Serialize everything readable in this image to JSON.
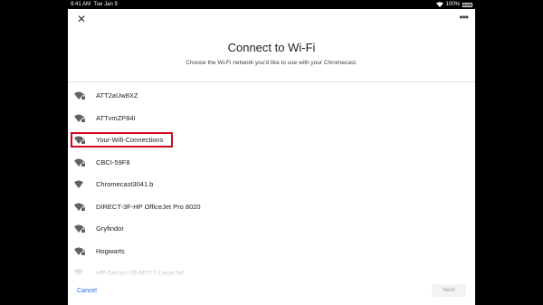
{
  "status_bar": {
    "time": "9:41 AM",
    "date": "Tue Jan 9",
    "battery": "100%"
  },
  "header": {
    "close_icon": "close-icon",
    "more_icon": "more-dots-icon",
    "more_label": "•••"
  },
  "title": "Connect to Wi-Fi",
  "subtitle": "Choose the Wi-Fi network you'd like to use with your Chromecast.",
  "networks": [
    {
      "name": "ATT2aUw8XZ",
      "icon": "wifi-locked-icon"
    },
    {
      "name": "ATTvmZP84I",
      "icon": "wifi-locked-icon"
    },
    {
      "name": "Your-Wifi-Connections",
      "icon": "wifi-locked-icon",
      "highlighted": true
    },
    {
      "name": "CBCI-59F8",
      "icon": "wifi-locked-icon"
    },
    {
      "name": "Chromecast3041.b",
      "icon": "wifi-icon"
    },
    {
      "name": "DIRECT-3F-HP OfficeJet Pro 8020",
      "icon": "wifi-locked-icon"
    },
    {
      "name": "Gryfindor",
      "icon": "wifi-locked-icon"
    },
    {
      "name": "Hogwarts",
      "icon": "wifi-locked-icon"
    },
    {
      "name": "HP-Setup>28-M277 LaserJet",
      "icon": "wifi-icon"
    }
  ],
  "footer": {
    "cancel_label": "Cancel",
    "next_label": "Next"
  },
  "colors": {
    "accent": "#1a73e8",
    "highlight": "#d10b1f"
  }
}
